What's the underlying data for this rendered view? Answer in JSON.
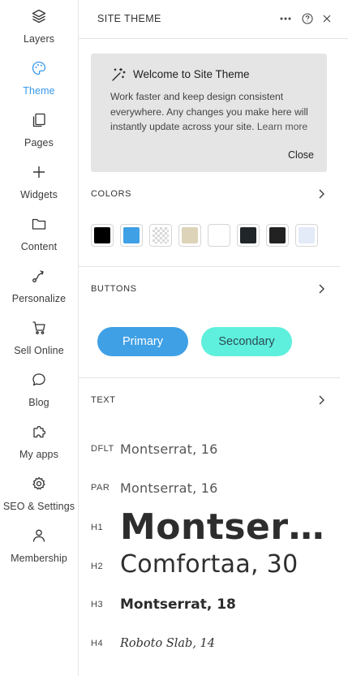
{
  "sidebar": {
    "items": [
      {
        "label": "Layers",
        "icon": "layers-icon",
        "active": false
      },
      {
        "label": "Theme",
        "icon": "palette-icon",
        "active": true
      },
      {
        "label": "Pages",
        "icon": "pages-icon",
        "active": false
      },
      {
        "label": "Widgets",
        "icon": "plus-icon",
        "active": false
      },
      {
        "label": "Content",
        "icon": "folder-icon",
        "active": false
      },
      {
        "label": "Personalize",
        "icon": "personalize-icon",
        "active": false
      },
      {
        "label": "Sell Online",
        "icon": "cart-icon",
        "active": false
      },
      {
        "label": "Blog",
        "icon": "chat-bubble-icon",
        "active": false
      },
      {
        "label": "My apps",
        "icon": "puzzle-icon",
        "active": false
      },
      {
        "label": "SEO & Settings",
        "icon": "gear-icon",
        "active": false
      },
      {
        "label": "Membership",
        "icon": "person-icon",
        "active": false
      }
    ],
    "accent_color": "#3899ec"
  },
  "panel": {
    "title": "SITE THEME"
  },
  "welcome": {
    "title": "Welcome to Site Theme",
    "body": "Work faster and keep design consistent everywhere. Any changes you make here will instantly update across your site.",
    "link": "Learn more",
    "close": "Close"
  },
  "sections": {
    "colors": "COLORS",
    "buttons": "BUTTONS",
    "text": "TEXT"
  },
  "colors": [
    {
      "name": "black",
      "hex": "#000000"
    },
    {
      "name": "blue",
      "hex": "#3fa0e5"
    },
    {
      "name": "transparent",
      "hex": "transparent"
    },
    {
      "name": "beige",
      "hex": "#ddd3b8"
    },
    {
      "name": "white",
      "hex": "#ffffff"
    },
    {
      "name": "charcoal",
      "hex": "#1f2528"
    },
    {
      "name": "near-black",
      "hex": "#222222"
    },
    {
      "name": "pale-blue",
      "hex": "#e3eaf8"
    }
  ],
  "buttons": {
    "primary": "Primary",
    "secondary": "Secondary",
    "primary_color": "#3fa0e5",
    "secondary_color": "#5ef0dc"
  },
  "text_styles": [
    {
      "tag": "DFLT",
      "sample": "Montserrat, 16"
    },
    {
      "tag": "PAR",
      "sample": "Montserrat, 16"
    },
    {
      "tag": "H1",
      "sample": "Montserr..."
    },
    {
      "tag": "H2",
      "sample": "Comfortaa, 30"
    },
    {
      "tag": "H3",
      "sample": "Montserrat, 18"
    },
    {
      "tag": "H4",
      "sample": "Roboto Slab, 14"
    }
  ]
}
